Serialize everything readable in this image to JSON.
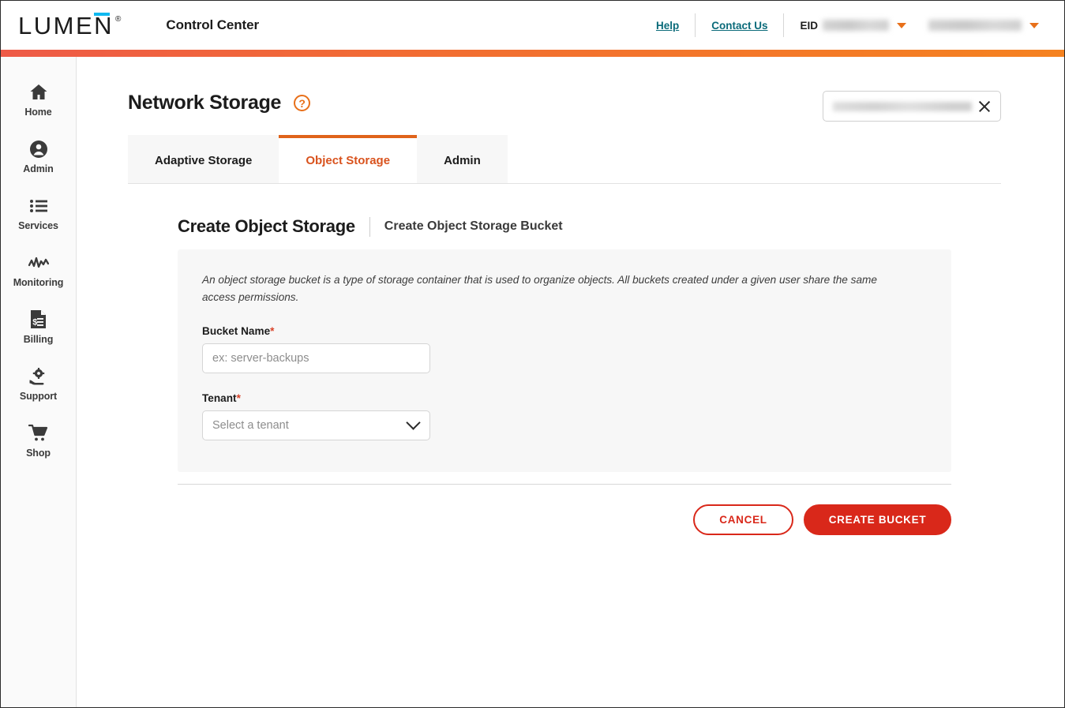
{
  "header": {
    "logo_text": "LUMEN",
    "logo_registered": "®",
    "app_title": "Control Center",
    "help_label": "Help",
    "contact_label": "Contact Us",
    "eid_label": "EID",
    "eid_value": "",
    "account_value": "",
    "eid_chevron_icon": "chevron-down-icon",
    "account_chevron_icon": "chevron-down-icon"
  },
  "sidebar": {
    "items": [
      {
        "label": "Home",
        "icon": "home-icon"
      },
      {
        "label": "Admin",
        "icon": "user-circle-icon"
      },
      {
        "label": "Services",
        "icon": "list-icon"
      },
      {
        "label": "Monitoring",
        "icon": "activity-icon"
      },
      {
        "label": "Billing",
        "icon": "invoice-icon"
      },
      {
        "label": "Support",
        "icon": "support-hand-gear-icon"
      },
      {
        "label": "Shop",
        "icon": "shopping-cart-icon"
      }
    ]
  },
  "page": {
    "title": "Network Storage",
    "help_icon": "question-mark-circle-icon",
    "search_value": "",
    "search_clear_icon": "close-icon"
  },
  "tabs": [
    {
      "label": "Adaptive Storage",
      "active": false
    },
    {
      "label": "Object Storage",
      "active": true
    },
    {
      "label": "Admin",
      "active": false
    }
  ],
  "section": {
    "title": "Create Object Storage",
    "subtitle": "Create Object Storage Bucket"
  },
  "form": {
    "description": "An object storage bucket is a type of storage container that is used to organize objects. All buckets created under a given user share the same access permissions.",
    "bucket_name": {
      "label": "Bucket Name",
      "required_marker": "*",
      "value": "",
      "placeholder": "ex: server-backups"
    },
    "tenant": {
      "label": "Tenant",
      "required_marker": "*",
      "selected": "Select a tenant",
      "chevron_icon": "chevron-down-icon"
    }
  },
  "actions": {
    "cancel_label": "CANCEL",
    "create_label": "CREATE BUCKET"
  },
  "colors": {
    "brand_red": "#d9281a",
    "accent_orange": "#e8701a",
    "link_teal": "#0b6b7a",
    "gradient_start": "#ee5a47",
    "gradient_end": "#f58220",
    "logo_blue": "#0fb9f0"
  }
}
